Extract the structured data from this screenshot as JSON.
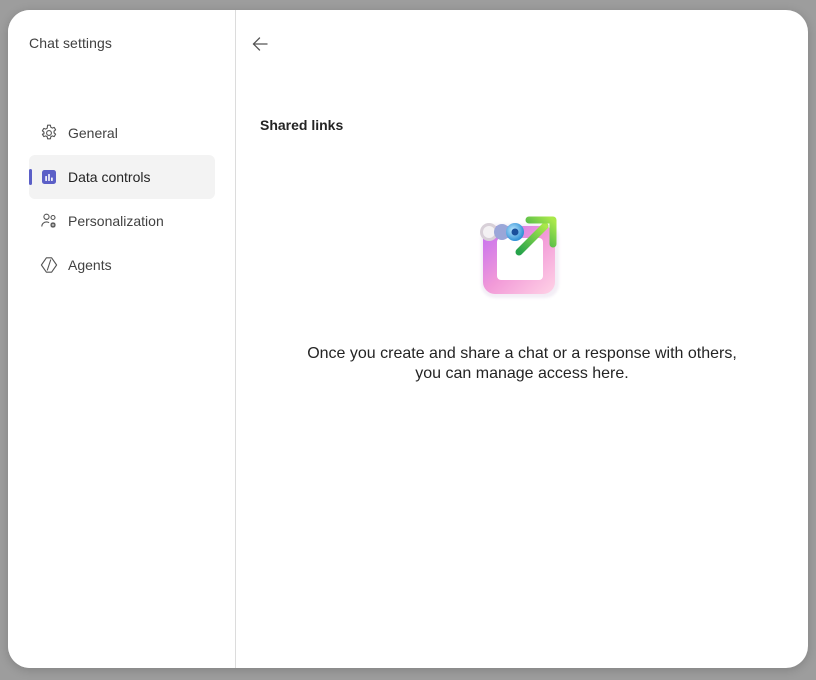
{
  "sidebar": {
    "title": "Chat settings",
    "items": [
      {
        "label": "General",
        "icon": "gear-icon",
        "active": false
      },
      {
        "label": "Data controls",
        "icon": "data-controls-icon",
        "active": true
      },
      {
        "label": "Personalization",
        "icon": "person-settings-icon",
        "active": false
      },
      {
        "label": "Agents",
        "icon": "agents-icon",
        "active": false
      }
    ]
  },
  "main": {
    "back_icon": "arrow-left-icon",
    "section_title": "Shared links",
    "illustration_icon": "shared-links-illustration",
    "empty_message_line1": "Once you create and share a chat or a response with others,",
    "empty_message_line2": "you can manage access here."
  },
  "colors": {
    "accent": "#5b5fc7",
    "active_bg": "#f3f3f3",
    "text_primary": "#242424",
    "text_secondary": "#424242",
    "divider": "#dcdcdc"
  }
}
